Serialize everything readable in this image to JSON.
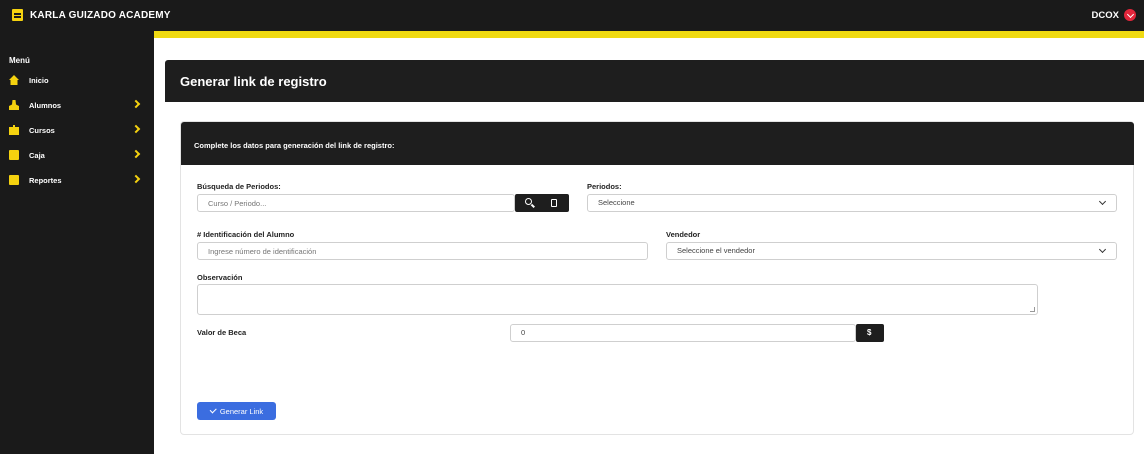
{
  "app": {
    "brand": "KARLA GUIZADO ACADEMY",
    "user": "DCOX"
  },
  "sidebar": {
    "menu_title": "Menú",
    "items": [
      {
        "label": "Inicio",
        "icon": "home-icon",
        "has_submenu": false
      },
      {
        "label": "Alumnos",
        "icon": "user-icon",
        "has_submenu": true
      },
      {
        "label": "Cursos",
        "icon": "group-icon",
        "has_submenu": true
      },
      {
        "label": "Caja",
        "icon": "cash-box-icon",
        "has_submenu": true
      },
      {
        "label": "Reportes",
        "icon": "report-icon",
        "has_submenu": true
      }
    ]
  },
  "page": {
    "title": "Generar link de registro"
  },
  "card": {
    "header": "Complete los datos para generación del link de registro:"
  },
  "form": {
    "search_periods": {
      "label": "Búsqueda de Periodos:",
      "placeholder": "Curso / Periodo..."
    },
    "periods": {
      "label": "Periodos:",
      "value": "Seleccione"
    },
    "student_id": {
      "label": "# Identificación del Alumno",
      "placeholder": "Ingrese número de identificación"
    },
    "seller": {
      "label": "Vendedor",
      "value": "Seleccione el vendedor"
    },
    "observation": {
      "label": "Observación"
    },
    "scholarship": {
      "label": "Valor de Beca",
      "value": "0",
      "addon": "$"
    },
    "submit_label": "Generar Link"
  },
  "colors": {
    "accent": "#f5d20f",
    "dark": "#1e1e1e",
    "primary": "#3b6de0",
    "user_badge": "#e3263b"
  }
}
